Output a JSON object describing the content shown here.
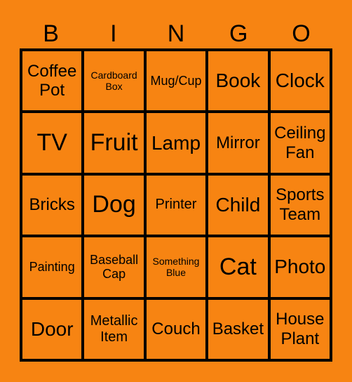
{
  "header": [
    "B",
    "I",
    "N",
    "G",
    "O"
  ],
  "cells": [
    {
      "label": "Coffee Pot",
      "size": "s24"
    },
    {
      "label": "Cardboard Box",
      "size": "s14"
    },
    {
      "label": "Mug/Cup",
      "size": "s18"
    },
    {
      "label": "Book",
      "size": "s28"
    },
    {
      "label": "Clock",
      "size": "s28"
    },
    {
      "label": "TV",
      "size": "s34"
    },
    {
      "label": "Fruit",
      "size": "s34"
    },
    {
      "label": "Lamp",
      "size": "s28"
    },
    {
      "label": "Mirror",
      "size": "s24"
    },
    {
      "label": "Ceiling Fan",
      "size": "s24"
    },
    {
      "label": "Bricks",
      "size": "s24"
    },
    {
      "label": "Dog",
      "size": "s34"
    },
    {
      "label": "Printer",
      "size": "s20"
    },
    {
      "label": "Child",
      "size": "s28"
    },
    {
      "label": "Sports Team",
      "size": "s24"
    },
    {
      "label": "Painting",
      "size": "s18"
    },
    {
      "label": "Baseball Cap",
      "size": "s18"
    },
    {
      "label": "Something Blue",
      "size": "s14"
    },
    {
      "label": "Cat",
      "size": "s34"
    },
    {
      "label": "Photo",
      "size": "s28"
    },
    {
      "label": "Door",
      "size": "s28"
    },
    {
      "label": "Metallic Item",
      "size": "s20"
    },
    {
      "label": "Couch",
      "size": "s24"
    },
    {
      "label": "Basket",
      "size": "s24"
    },
    {
      "label": "House Plant",
      "size": "s24"
    }
  ]
}
